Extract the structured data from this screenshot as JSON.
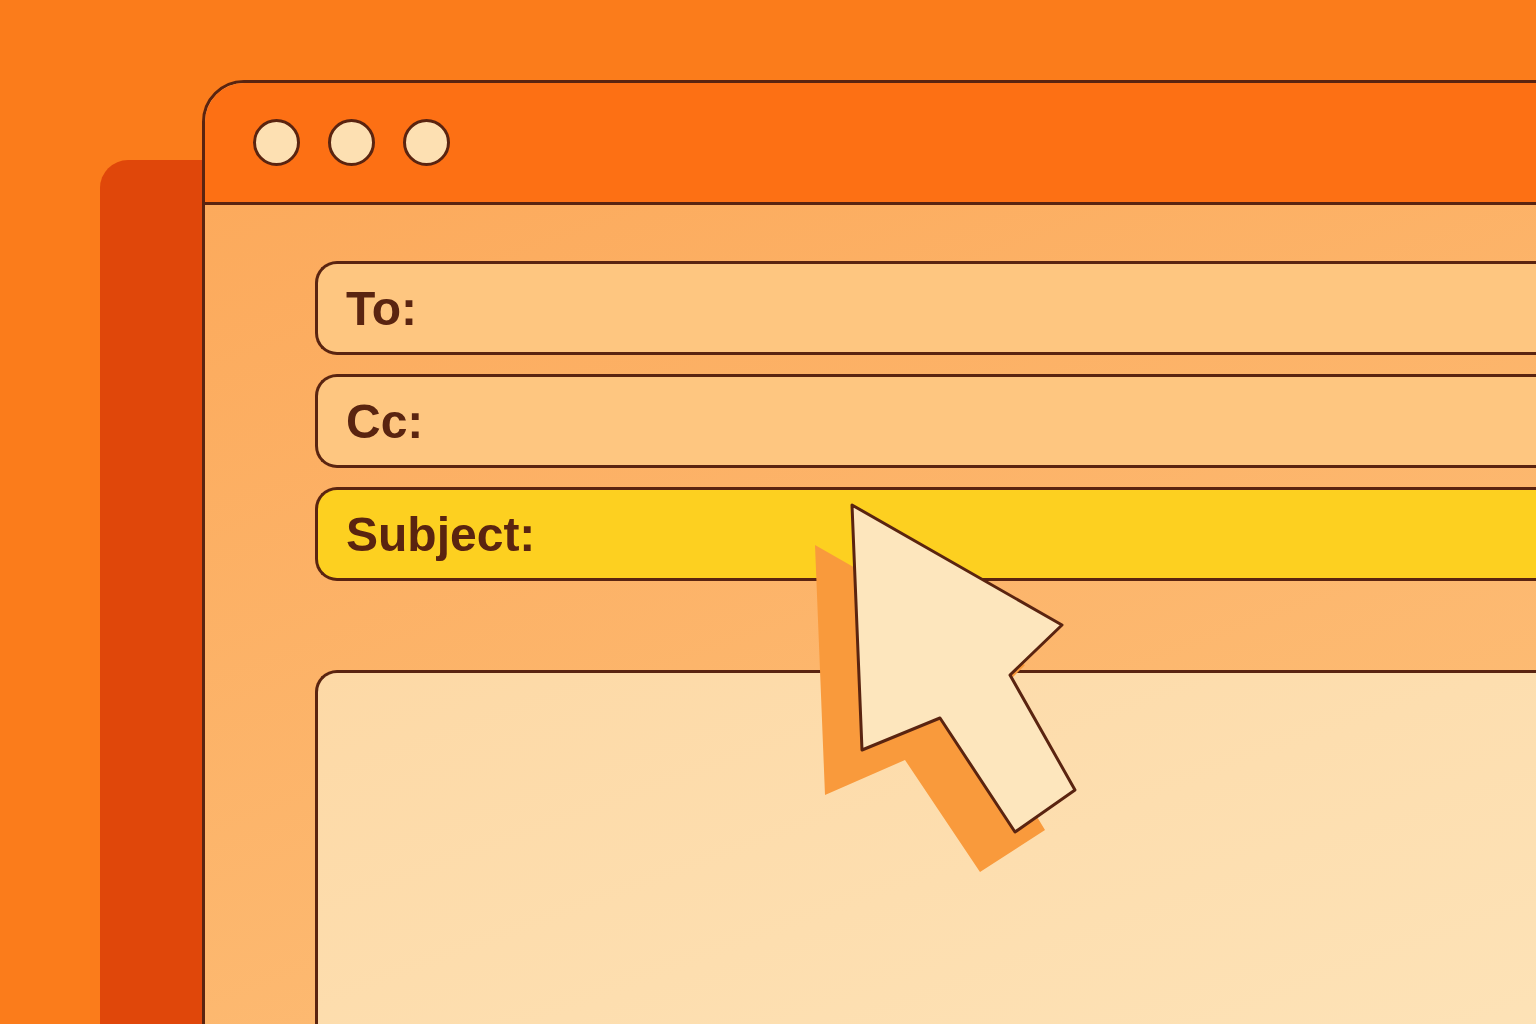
{
  "window": {
    "controls": [
      {
        "kind": "dot"
      },
      {
        "kind": "dot"
      },
      {
        "kind": "dot"
      }
    ]
  },
  "fields": [
    {
      "label": "To:",
      "focused": false
    },
    {
      "label": "Cc:",
      "focused": false
    },
    {
      "label": "Subject:",
      "focused": true
    }
  ],
  "body": {
    "kind": "textarea"
  },
  "pointer": {
    "kind": "arrow"
  }
}
